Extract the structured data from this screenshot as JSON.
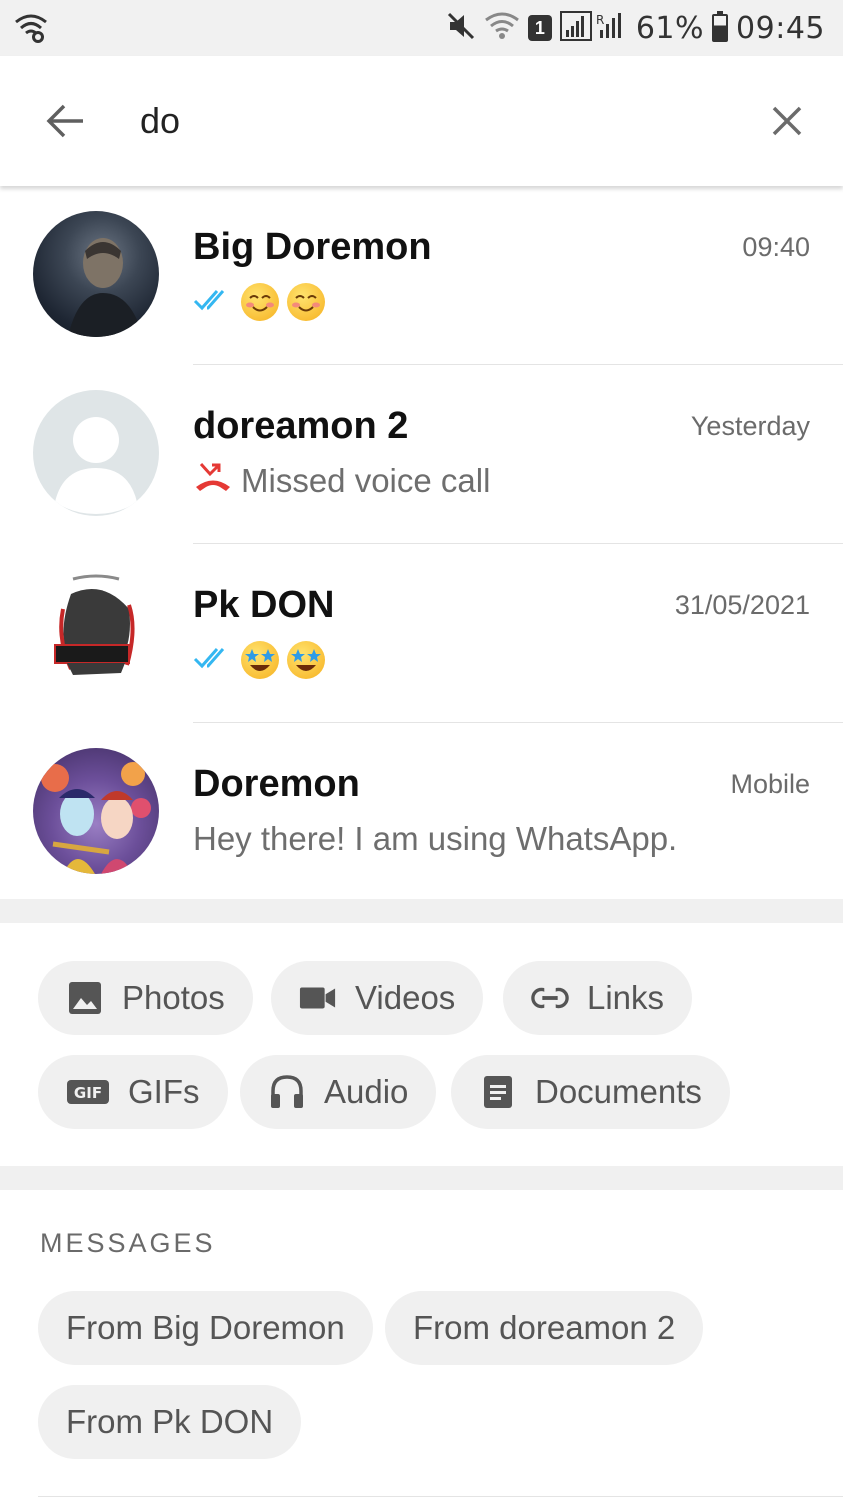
{
  "status_bar": {
    "battery": "61%",
    "time": "09:45",
    "sim_slot": "1",
    "icons": [
      "wifi-calling-icon",
      "mute-icon",
      "wifi-icon",
      "sim-icon",
      "signal-icon",
      "battery-icon"
    ]
  },
  "search": {
    "query": "do",
    "back_icon": "arrow-left-icon",
    "clear_icon": "close-icon"
  },
  "chats": [
    {
      "name": "Big Doremon",
      "time": "09:40",
      "ticks": "double-check-icon",
      "preview_emojis": [
        "smiling-face-icon",
        "smiling-face-icon"
      ],
      "avatar": "photo-man"
    },
    {
      "name": "doreamon 2",
      "time": "Yesterday",
      "preview_icon": "missed-call-icon",
      "preview_text": "Missed voice call",
      "avatar": "default-contact"
    },
    {
      "name": "Pk DON",
      "time": "31/05/2021",
      "ticks": "double-check-icon",
      "preview_emojis": [
        "star-struck-icon",
        "star-struck-icon"
      ],
      "avatar": "photo-logo"
    },
    {
      "name": "Doremon",
      "time": "Mobile",
      "preview_text": "Hey there! I am using WhatsApp.",
      "avatar": "photo-art"
    }
  ],
  "media_filters": [
    {
      "label": "Photos",
      "icon": "photo-icon"
    },
    {
      "label": "Videos",
      "icon": "video-icon"
    },
    {
      "label": "Links",
      "icon": "link-icon"
    },
    {
      "label": "GIFs",
      "icon": "gif-icon"
    },
    {
      "label": "Audio",
      "icon": "headphones-icon"
    },
    {
      "label": "Documents",
      "icon": "document-icon"
    }
  ],
  "messages_section": {
    "title": "MESSAGES",
    "filters": [
      "From Big Doremon",
      "From doreamon 2",
      "From Pk DON"
    ]
  },
  "colors": {
    "tick_blue": "#34b7f1",
    "missed_red": "#e53935",
    "chip_bg": "#f0f0f0",
    "separator": "#f0f0f0"
  }
}
